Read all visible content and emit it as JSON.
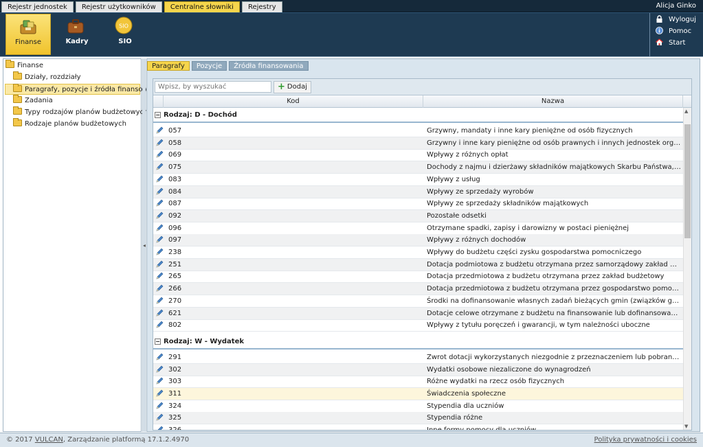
{
  "top_tabs": [
    {
      "label": "Rejestr jednostek",
      "active": false
    },
    {
      "label": "Rejestr użytkowników",
      "active": false
    },
    {
      "label": "Centralne słowniki",
      "active": true
    },
    {
      "label": "Rejestry",
      "active": false
    }
  ],
  "user": {
    "name": "Alicja Ginko"
  },
  "modules": [
    {
      "label": "Finanse",
      "icon": "finance-icon",
      "active": true
    },
    {
      "label": "Kadry",
      "icon": "briefcase-icon",
      "active": false
    },
    {
      "label": "SIO",
      "icon": "sio-icon",
      "badge": "SIO",
      "active": false
    }
  ],
  "right_menu": [
    {
      "label": "Wyloguj",
      "icon": "lock-icon"
    },
    {
      "label": "Pomoc",
      "icon": "info-icon"
    },
    {
      "label": "Start",
      "icon": "home-icon"
    }
  ],
  "tree": {
    "root": "Finanse",
    "items": [
      {
        "label": "Działy, rozdziały",
        "selected": false
      },
      {
        "label": "Paragrafy, pozycje i źródła finansowania",
        "selected": true
      },
      {
        "label": "Zadania",
        "selected": false
      },
      {
        "label": "Typy rodzajów planów budżetowych",
        "selected": false
      },
      {
        "label": "Rodzaje planów budżetowych",
        "selected": false
      }
    ]
  },
  "sub_tabs": [
    {
      "label": "Paragrafy",
      "active": true
    },
    {
      "label": "Pozycje",
      "active": false
    },
    {
      "label": "Źródła finansowania",
      "active": false
    }
  ],
  "toolbar": {
    "search_placeholder": "Wpisz, by wyszukać",
    "add_label": "Dodaj"
  },
  "columns": {
    "kod": "Kod",
    "nazwa": "Nazwa"
  },
  "groups": [
    {
      "title": "Rodzaj: D - Dochód",
      "toggle": "−",
      "rows": [
        {
          "kod": "057",
          "nazwa": "Grzywny, mandaty i inne kary pieniężne od osób fizycznych"
        },
        {
          "kod": "058",
          "nazwa": "Grzywny i inne kary pieniężne od osób prawnych i innych jednostek organizacyjnych"
        },
        {
          "kod": "069",
          "nazwa": "Wpływy z różnych opłat"
        },
        {
          "kod": "075",
          "nazwa": "Dochody z najmu i dzierżawy składników majątkowych Skarbu Państwa, jednostek samorządu terytorialnego"
        },
        {
          "kod": "083",
          "nazwa": "Wpływy z usług"
        },
        {
          "kod": "084",
          "nazwa": "Wpływy ze sprzedaży wyrobów"
        },
        {
          "kod": "087",
          "nazwa": "Wpływy ze sprzedaży składników majątkowych"
        },
        {
          "kod": "092",
          "nazwa": "Pozostałe odsetki"
        },
        {
          "kod": "096",
          "nazwa": "Otrzymane spadki, zapisy i darowizny w postaci pieniężnej"
        },
        {
          "kod": "097",
          "nazwa": "Wpływy z różnych dochodów"
        },
        {
          "kod": "238",
          "nazwa": "Wpływy do budżetu części zysku gospodarstwa pomocniczego"
        },
        {
          "kod": "251",
          "nazwa": "Dotacja podmiotowa z budżetu otrzymana przez samorządowy zakład budżetowy"
        },
        {
          "kod": "265",
          "nazwa": "Dotacja przedmiotowa z budżetu otrzymana przez zakład budżetowy"
        },
        {
          "kod": "266",
          "nazwa": "Dotacja przedmiotowa z budżetu otrzymana przez gospodarstwo pomocnicze"
        },
        {
          "kod": "270",
          "nazwa": "Środki na dofinansowanie własnych zadań bieżących gmin (związków gmin), powiatów (związków powiatów)"
        },
        {
          "kod": "621",
          "nazwa": "Dotacje celowe otrzymane z budżetu na finansowanie lub dofinansowanie kosztów realizacji inwestycji"
        },
        {
          "kod": "802",
          "nazwa": "Wpływy z tytułu poręczeń i gwarancji, w tym należności uboczne"
        }
      ]
    },
    {
      "title": "Rodzaj: W - Wydatek",
      "toggle": "−",
      "rows": [
        {
          "kod": "291",
          "nazwa": "Zwrot dotacji wykorzystanych niezgodnie z przeznaczeniem lub pobranych w nadmiernej wysokości"
        },
        {
          "kod": "302",
          "nazwa": "Wydatki osobowe niezaliczone do wynagrodzeń"
        },
        {
          "kod": "303",
          "nazwa": "Różne wydatki na rzecz osób fizycznych"
        },
        {
          "kod": "311",
          "nazwa": "Świadczenia społeczne",
          "highlight": true
        },
        {
          "kod": "324",
          "nazwa": "Stypendia dla uczniów"
        },
        {
          "kod": "325",
          "nazwa": "Stypendia różne"
        },
        {
          "kod": "326",
          "nazwa": "Inne formy pomocy dla uczniów"
        }
      ]
    }
  ],
  "footer": {
    "copy_prefix": "© 2017 ",
    "brand": "VULCAN",
    "copy_suffix": ", Zarządzanie platformą 17.1.2.4970",
    "privacy": "Polityka prywatności i cookies"
  },
  "colors": {
    "accent": "#f6d54c",
    "header_bg": "#1e3a52",
    "selection": "#fbe9a6"
  }
}
